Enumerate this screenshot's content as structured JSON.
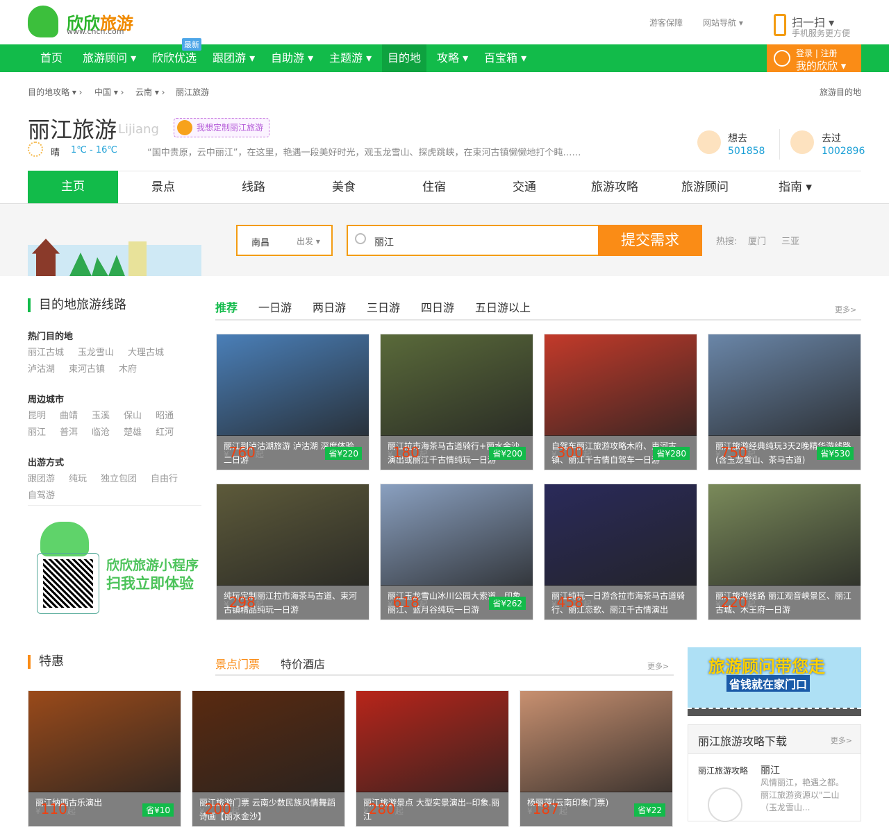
{
  "header": {
    "logo_name": "欣欣",
    "logo_name2": "旅游",
    "logo_url": "www.cncn.com",
    "links": [
      "游客保障",
      "网站导航 ▾"
    ],
    "scan": "扫一扫 ▾",
    "scan_sub": "手机服务更方便"
  },
  "nav": {
    "items": [
      "首页",
      "旅游顾问 ▾",
      "欣欣优选",
      "跟团游 ▾",
      "自助游 ▾",
      "主题游 ▾",
      "目的地",
      "攻略 ▾",
      "百宝箱 ▾"
    ],
    "new_badge": "最新",
    "login": "登录 | 注册",
    "my": "我的欣欣 ▾"
  },
  "breadcrumb": [
    "目的地攻略 ▾ ›",
    "中国 ▾ ›",
    "云南 ▾ ›",
    "丽江旅游"
  ],
  "breadcrumb_right": "旅游目的地",
  "dest": {
    "title": "丽江旅游",
    "pinyin": "Lijiang",
    "custom": "我想定制丽江旅游",
    "weather": "晴",
    "temp": "1℃ - 16℃",
    "desc": "“国中贵原，云中丽江”，在这里，艳遇一段美好时光，观玉龙雪山、探虎跳峡，在束河古镇懒懒地打个盹……",
    "want_label": "想去",
    "want": "501858",
    "been_label": "去过",
    "been": "1002896"
  },
  "tabs": [
    "主页",
    "景点",
    "线路",
    "美食",
    "住宿",
    "交通",
    "旅游攻略",
    "旅游顾问",
    "指南 ▾"
  ],
  "search": {
    "from": "南昌",
    "from_label": "出发 ▾",
    "value": "丽江",
    "submit": "提交需求",
    "hot_label": "热搜:",
    "hot": [
      "厦门",
      "三亚"
    ]
  },
  "routes": {
    "title": "目的地旅游线路",
    "tabs": [
      "推荐",
      "一日游",
      "两日游",
      "三日游",
      "四日游",
      "五日游以上"
    ],
    "more": "更多>",
    "cards": [
      {
        "title": "丽江到泸沽湖旅游 泸沽湖 深度体验二日游",
        "price": "760",
        "save": "省¥220",
        "c": "#4a7fb8"
      },
      {
        "title": "丽江拉市海茶马古道骑行+丽水金沙演出或丽江千古情纯玩一日游",
        "price": "180",
        "save": "省¥200",
        "c": "#5a6a3a"
      },
      {
        "title": "自驾车丽江旅游攻略木府、束河古镇、丽江千古情自驾车一日游",
        "price": "300",
        "save": "省¥280",
        "c": "#c33a2a"
      },
      {
        "title": "丽江旅游经典纯玩3天2晚精华游线路(含玉龙雪山、茶马古道)",
        "price": "750",
        "save": "省¥530",
        "c": "#6a86a8"
      },
      {
        "title": "纯玩定制丽江拉市海茶马古道、束河古镇精品纯玩一日游",
        "price": "298",
        "save": "",
        "c": "#5d5a3a"
      },
      {
        "title": "丽江玉龙雪山冰川公园大索道、印象丽江、蓝月谷纯玩一日游",
        "price": "618",
        "save": "省¥262",
        "c": "#8aa0c0"
      },
      {
        "title": "丽江纯玩一日游含拉市海茶马古道骑行、丽江恋歌、丽江千古情演出",
        "price": "458",
        "save": "",
        "c": "#2a2a5a"
      },
      {
        "title": "丽江旅游线路 丽江观音峡景区、丽江古城、木王府一日游",
        "price": "220",
        "save": "",
        "c": "#7a8a5a"
      }
    ]
  },
  "sidebar": {
    "groups": [
      {
        "title": "热门目的地",
        "items": [
          "丽江古城",
          "玉龙雪山",
          "大理古城",
          "泸沽湖",
          "束河古镇",
          "木府"
        ]
      },
      {
        "title": "周边城市",
        "items": [
          "昆明",
          "曲靖",
          "玉溪",
          "保山",
          "昭通",
          "丽江",
          "普洱",
          "临沧",
          "楚雄",
          "红河"
        ]
      },
      {
        "title": "出游方式",
        "items": [
          "跟团游",
          "纯玩",
          "独立包团",
          "自由行",
          "自驾游"
        ]
      }
    ],
    "mini1": "欣欣旅游小程序",
    "mini2": "扫我立即体验"
  },
  "deals": {
    "title": "特惠",
    "tabs": [
      "景点门票",
      "特价酒店"
    ],
    "more": "更多>",
    "cards": [
      {
        "title": "丽江纳西古乐演出",
        "price": "110",
        "save": "省¥10",
        "c": "#9a4a1a"
      },
      {
        "title": "丽江旅游门票 云南少数民族风情舞蹈诗画【丽水金沙】",
        "price": "200",
        "save": "",
        "c": "#5a2a10"
      },
      {
        "title": "丽江旅游景点 大型实景演出--印象.丽江",
        "price": "280",
        "save": "",
        "c": "#b8251a"
      },
      {
        "title": "杨丽萍(云南印象门票)",
        "price": "187",
        "save": "省¥22",
        "c": "#c89070"
      }
    ]
  },
  "right": {
    "banner1": "旅游顾问带您走",
    "banner2": "省钱就在家门口",
    "dl_title": "丽江旅游攻略下载",
    "dl_more": "更多>",
    "dl_label": "丽江旅游攻略",
    "dl_name": "丽江",
    "dl_desc": "风情丽江，艳遇之都。丽江旅游资源以\"二山（玉龙雪山..."
  },
  "price_unit": "起",
  "yen": "¥"
}
